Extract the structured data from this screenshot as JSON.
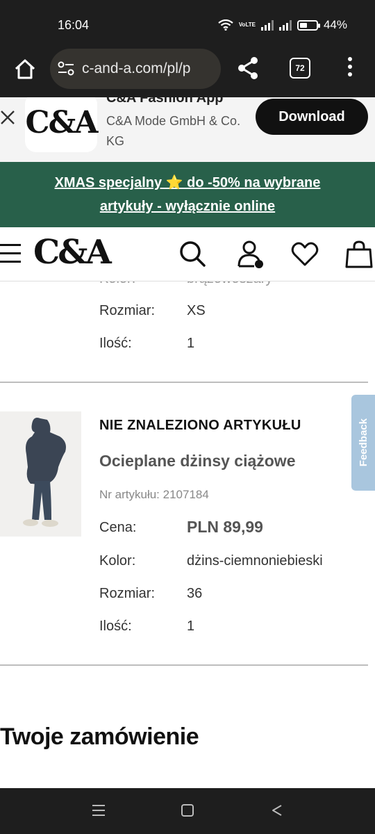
{
  "status_bar": {
    "time": "16:04",
    "volte": "VoLTE",
    "battery_percent": "44%",
    "battery_level": 0.44
  },
  "browser": {
    "url": "c-and-a.com/pl/p",
    "tab_count": "72"
  },
  "app_banner": {
    "title": "C&A Fashion App",
    "company": "C&A Mode GmbH & Co. KG",
    "logo_text": "C&A",
    "download_label": "Download"
  },
  "promo": {
    "text": "XMAS specjalny ⭐ do -50% na wybrane artykuły - wyłącznie online"
  },
  "site_header": {
    "logo_text": "C&A"
  },
  "item1": {
    "color_label": "Kolor:",
    "color_value": "brązowoszary",
    "size_label": "Rozmiar:",
    "size_value": "XS",
    "qty_label": "Ilość:",
    "qty_value": "1"
  },
  "item2": {
    "status": "NIE ZNALEZIONO ARTYKUŁU",
    "name": "Ocieplane dżinsy ciążowe",
    "article_number": "Nr artykułu: 2107184",
    "price_label": "Cena:",
    "price_value": "PLN 89,99",
    "color_label": "Kolor:",
    "color_value": "dżins-ciemnoniebieski",
    "size_label": "Rozmiar:",
    "size_value": "36",
    "qty_label": "Ilość:",
    "qty_value": "1"
  },
  "order": {
    "title": "Twoje zamówienie"
  },
  "feedback": {
    "label": "Feedback"
  },
  "colors": {
    "promo_bg": "#28604a",
    "feedback_bg": "#a9c6de",
    "system_bar": "#1e1e1e"
  }
}
